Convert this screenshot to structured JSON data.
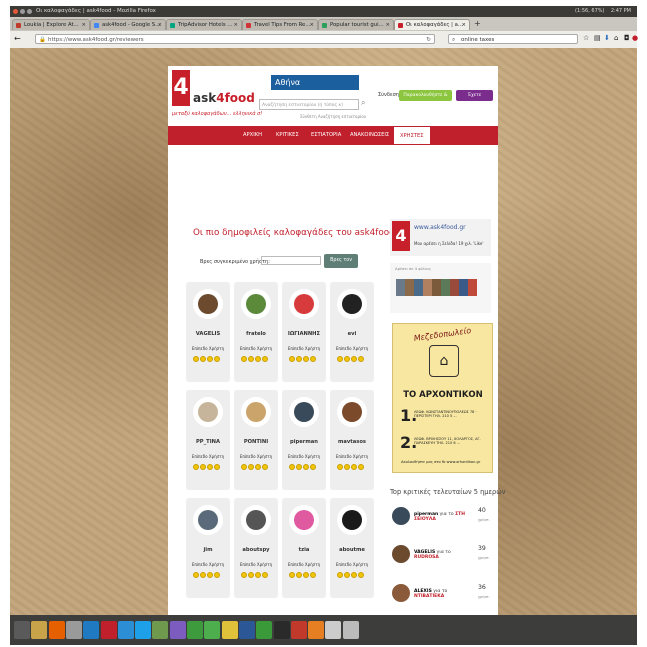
{
  "window": {
    "title": "Οι καλοφαγάδες | ask4food - Mozilla Firefox",
    "time": "2:47 PM",
    "battery": "(1:56, 67%)"
  },
  "tabs": [
    {
      "label": "Loukia | Explore At...",
      "color": "#c0392b"
    },
    {
      "label": "ask4food - Google S...",
      "color": "#4285f4"
    },
    {
      "label": "TripAdvisor Hotels ...",
      "color": "#00a680"
    },
    {
      "label": "Travel Tips From Re...",
      "color": "#d03434"
    },
    {
      "label": "Popular tourist gui...",
      "color": "#2e9e5b"
    },
    {
      "label": "Οι καλοφαγάδες | a...",
      "color": "#c8202a"
    }
  ],
  "nav": {
    "url": "https://www.ask4food.gr/reviewers",
    "search_value": "online taxes"
  },
  "site": {
    "logo_letter": "4",
    "logo_word": "ask",
    "logo_word2": "4food",
    "tagline": "μεταξύ καλοφαγάδων... ελληνικά σ!",
    "city": "Αθήνα",
    "search_placeholder": "Αναζήτηση εστιατορίου (ή τύπος κ)",
    "advanced_search": "Σύνθετη Αναζήτηση εστιατορίου",
    "login": "Σύνδεση",
    "signup_button": "Παρακολουθήστε & Εγγραφή",
    "owner_button": "Έχετε Εστιατόριο;",
    "menu": [
      "ΑΡΧΙΚΗ",
      "ΚΡΙΤΙΚΕΣ",
      "ΕΣΤΙΑΤΟΡΙΑ",
      "ΑΝΑΚΟΙΝΩΣΕΙΣ",
      "ΧΡΗΣΤΕΣ"
    ]
  },
  "main": {
    "title": "Οι πιο δημοφιλείς καλοφαγάδες του ask4food.gr",
    "search_label": "Βρες συγκεκριμένο χρήστη:",
    "search_button": "Βρες τον",
    "user_role": "Επίπεδο Χρήστη",
    "users": [
      {
        "name": "VAGELIS",
        "color": "#6b4a2e"
      },
      {
        "name": "fratelo",
        "color": "#5a8a3a"
      },
      {
        "name": "ΙΩΓΙΑΝΝΗΣ",
        "color": "#d83b3b"
      },
      {
        "name": "evi",
        "color": "#222222"
      },
      {
        "name": "PP_TINA",
        "color": "#c7b59b"
      },
      {
        "name": "PONTINI",
        "color": "#caa46a"
      },
      {
        "name": "piperman",
        "color": "#394a5a"
      },
      {
        "name": "mavtasos",
        "color": "#7a4a2a"
      },
      {
        "name": "jim",
        "color": "#5a6a7a"
      },
      {
        "name": "aboutspy",
        "color": "#555555"
      },
      {
        "name": "tzia",
        "color": "#e05aa0"
      },
      {
        "name": "aboutme",
        "color": "#1a1a1a"
      }
    ]
  },
  "sidebar": {
    "fb_name": "www.ask4food.gr",
    "fb_like": "Μου αρέσει η Σελίδα!   19 χιλ. 'Like'",
    "friends_label": "Αρέσει σε 4 φίλους",
    "ad": {
      "title": "Μεζεδοπωλείο",
      "name": "ΤΟ ΑΡΧΟΝΤΙΚΟΝ",
      "branch1_num": "1.",
      "branch1": "ΛΕΩΦ. ΚΩΝΣΤΑΝΤΙΝΟΥΠΟΛΕΩΣ 78 · ΠΕΡΙΣΤΕΡΙ  ΤΗΛ. 210 5 ...",
      "branch2_num": "2.",
      "branch2": "ΛΕΩΦ. ΒΡΙΛΗΣΣΟΥ 11, ΧΟΛΑΡΓΟΣ, ΑΓ. ΠΑΡΑΣΚΕΥΗ  ΤΗΛ. 210 6 ...",
      "footer": "Ακολουθήστε μας στο fb          www.arhontikon.gr"
    },
    "reviews_title": "Top κριτικές τελευταίων 5 ημερών",
    "reviews": [
      {
        "user": "piperman",
        "mid": "για το",
        "restaurant": "ΣΤΗ ΣΕΙΟΥΛΑ",
        "count": "40",
        "unit": "χρήστ.",
        "color": "#394a5a"
      },
      {
        "user": "VAGELIS",
        "mid": "για το",
        "restaurant": "RUDROSA",
        "count": "39",
        "unit": "χρήστ.",
        "color": "#6b4a2e"
      },
      {
        "user": "ALEXIS",
        "mid": "για το",
        "restaurant": "ΝΤΙΒΑΤΙΕΚΑ",
        "count": "36",
        "unit": "χρήστ.",
        "color": "#8a5a3a"
      }
    ]
  },
  "taskbar": [
    {
      "name": "dash-icon",
      "color": "#5a5a5a"
    },
    {
      "name": "files-icon",
      "color": "#c9a34a"
    },
    {
      "name": "firefox-icon",
      "color": "#e66000"
    },
    {
      "name": "settings-icon",
      "color": "#9a9a9a"
    },
    {
      "name": "writer-icon",
      "color": "#1f7ac1"
    },
    {
      "name": "pdf-icon",
      "color": "#c0202c"
    },
    {
      "name": "chat-icon",
      "color": "#2c8fd6"
    },
    {
      "name": "skype-icon",
      "color": "#1ea0e8"
    },
    {
      "name": "tools-icon",
      "color": "#6f9a4d"
    },
    {
      "name": "viber-icon",
      "color": "#7c5cbf"
    },
    {
      "name": "calc-icon",
      "color": "#3d9b3d"
    },
    {
      "name": "image-icon",
      "color": "#4cae4c"
    },
    {
      "name": "notes-icon",
      "color": "#e0c23a"
    },
    {
      "name": "word-icon",
      "color": "#2b5797"
    },
    {
      "name": "vim-icon",
      "color": "#3a9a3a"
    },
    {
      "name": "terminal-icon",
      "color": "#2a2a2a"
    },
    {
      "name": "docs-icon",
      "color": "#c0392b"
    },
    {
      "name": "presentation-icon",
      "color": "#e67e22"
    },
    {
      "name": "drive-icon",
      "color": "#cccccc"
    },
    {
      "name": "trash-icon",
      "color": "#bbbbbb"
    }
  ]
}
